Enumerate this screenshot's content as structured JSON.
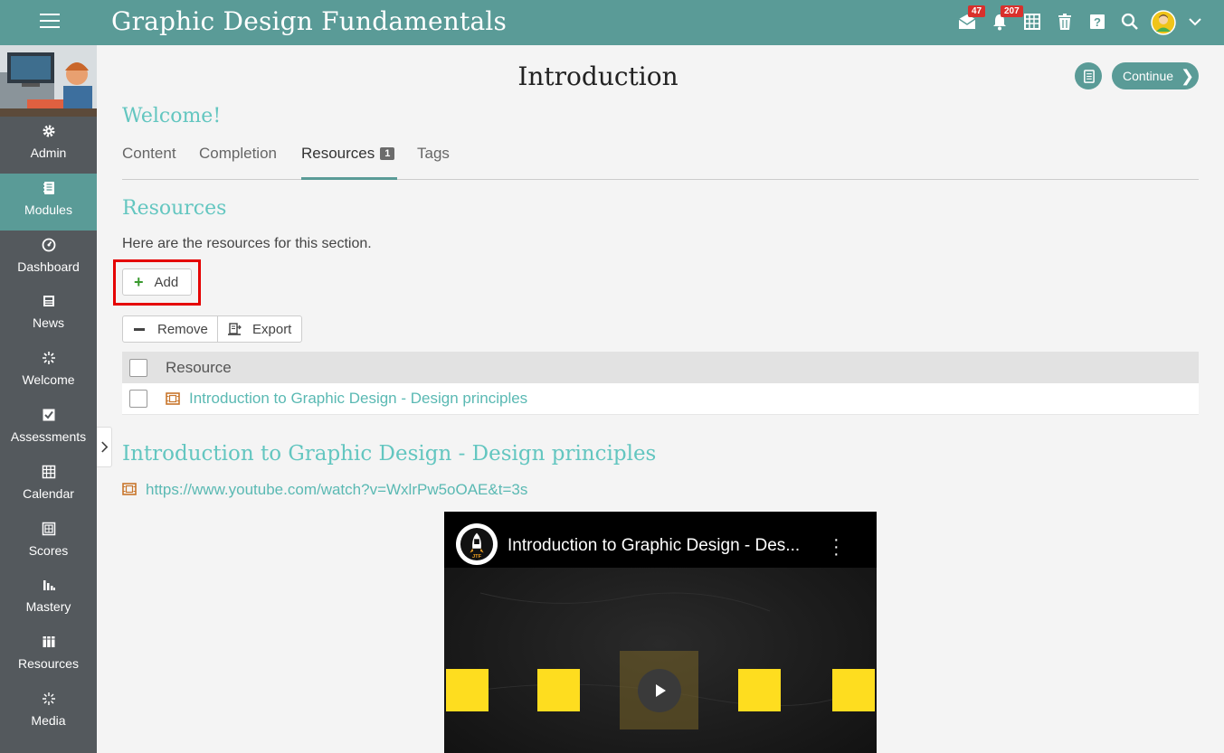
{
  "app": {
    "title": "Graphic Design Fundamentals"
  },
  "topbar": {
    "messages_count": "47",
    "notifications_count": "207"
  },
  "sidebar": {
    "items": [
      {
        "label": "Admin",
        "icon": "gear-icon"
      },
      {
        "label": "Modules",
        "icon": "notebook-icon",
        "active": true
      },
      {
        "label": "Dashboard",
        "icon": "gauge-icon"
      },
      {
        "label": "News",
        "icon": "newspaper-icon"
      },
      {
        "label": "Welcome",
        "icon": "sparkle-icon"
      },
      {
        "label": "Assessments",
        "icon": "checkbox-icon"
      },
      {
        "label": "Calendar",
        "icon": "calendar-icon"
      },
      {
        "label": "Scores",
        "icon": "scores-icon"
      },
      {
        "label": "Mastery",
        "icon": "bar-chart-icon"
      },
      {
        "label": "Resources",
        "icon": "books-icon"
      },
      {
        "label": "Media",
        "icon": "media-icon"
      }
    ]
  },
  "page": {
    "title": "Introduction",
    "continue_label": "Continue",
    "section_title": "Welcome!"
  },
  "tabs": [
    {
      "label": "Content"
    },
    {
      "label": "Completion"
    },
    {
      "label": "Resources",
      "count": "1",
      "active": true
    },
    {
      "label": "Tags"
    }
  ],
  "resources": {
    "heading": "Resources",
    "description": "Here are the resources for this section.",
    "add_label": "Add",
    "remove_label": "Remove",
    "export_label": "Export",
    "table": {
      "header": "Resource",
      "rows": [
        {
          "name": "Introduction to Graphic Design - Design principles",
          "type": "video"
        }
      ]
    }
  },
  "detail": {
    "title": "Introduction to Graphic Design - Design principles",
    "url": "https://www.youtube.com/watch?v=WxlrPw5oOAE&t=3s",
    "video_title": "Introduction to Graphic Design - Des..."
  },
  "colors": {
    "accent": "#5a9b97",
    "link": "#5ab9b3",
    "heading": "#63c6c0",
    "sidebar": "#54595d",
    "highlight": "#e50000"
  }
}
